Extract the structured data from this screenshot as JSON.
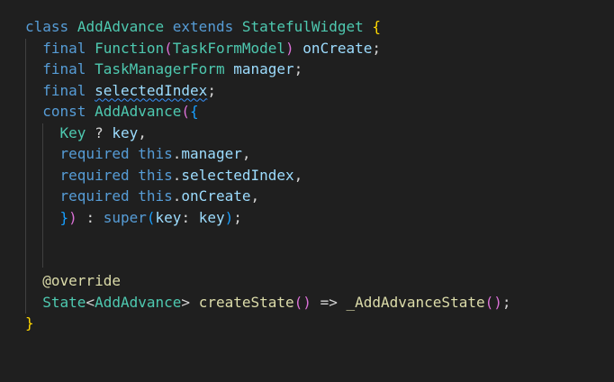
{
  "editor": {
    "language": "dart",
    "theme_colors": {
      "background": "#1f1f1f",
      "keyword": "#569cd6",
      "type": "#4ec9b0",
      "variable": "#9cdcfe",
      "function": "#dcdcaa",
      "plain": "#d4d4d4",
      "bracket_level_1": "#ffd700",
      "bracket_level_2": "#da70d6",
      "bracket_level_3": "#179fff",
      "squiggle": "#3794ff"
    },
    "lines": [
      [
        {
          "t": "class",
          "c": "kw"
        },
        {
          "t": " ",
          "c": "plain"
        },
        {
          "t": "AddAdvance",
          "c": "type"
        },
        {
          "t": " ",
          "c": "plain"
        },
        {
          "t": "extends",
          "c": "kw"
        },
        {
          "t": " ",
          "c": "plain"
        },
        {
          "t": "StatefulWidget",
          "c": "type"
        },
        {
          "t": " ",
          "c": "plain"
        },
        {
          "t": "{",
          "c": "br1"
        }
      ],
      [
        {
          "t": "  ",
          "c": "plain"
        },
        {
          "t": "final",
          "c": "kw"
        },
        {
          "t": " ",
          "c": "plain"
        },
        {
          "t": "Function",
          "c": "type"
        },
        {
          "t": "(",
          "c": "br2"
        },
        {
          "t": "TaskFormModel",
          "c": "type"
        },
        {
          "t": ")",
          "c": "br2"
        },
        {
          "t": " ",
          "c": "plain"
        },
        {
          "t": "onCreate",
          "c": "var"
        },
        {
          "t": ";",
          "c": "plain"
        }
      ],
      [
        {
          "t": "  ",
          "c": "plain"
        },
        {
          "t": "final",
          "c": "kw"
        },
        {
          "t": " ",
          "c": "plain"
        },
        {
          "t": "TaskManagerForm",
          "c": "type"
        },
        {
          "t": " ",
          "c": "plain"
        },
        {
          "t": "manager",
          "c": "var"
        },
        {
          "t": ";",
          "c": "plain"
        }
      ],
      [
        {
          "t": "  ",
          "c": "plain"
        },
        {
          "t": "final",
          "c": "kw"
        },
        {
          "t": " ",
          "c": "plain"
        },
        {
          "t": "selectedIndex",
          "c": "var",
          "squiggle": true
        },
        {
          "t": ";",
          "c": "plain"
        }
      ],
      [
        {
          "t": "  ",
          "c": "plain"
        },
        {
          "t": "const",
          "c": "kw"
        },
        {
          "t": " ",
          "c": "plain"
        },
        {
          "t": "AddAdvance",
          "c": "type"
        },
        {
          "t": "(",
          "c": "br2"
        },
        {
          "t": "{",
          "c": "br3"
        }
      ],
      [
        {
          "t": "    ",
          "c": "plain"
        },
        {
          "t": "Key",
          "c": "type"
        },
        {
          "t": " ? ",
          "c": "plain"
        },
        {
          "t": "key",
          "c": "var"
        },
        {
          "t": ",",
          "c": "plain"
        }
      ],
      [
        {
          "t": "    ",
          "c": "plain"
        },
        {
          "t": "required",
          "c": "kw"
        },
        {
          "t": " ",
          "c": "plain"
        },
        {
          "t": "this",
          "c": "kw"
        },
        {
          "t": ".",
          "c": "plain"
        },
        {
          "t": "manager",
          "c": "var"
        },
        {
          "t": ",",
          "c": "plain"
        }
      ],
      [
        {
          "t": "    ",
          "c": "plain"
        },
        {
          "t": "required",
          "c": "kw"
        },
        {
          "t": " ",
          "c": "plain"
        },
        {
          "t": "this",
          "c": "kw"
        },
        {
          "t": ".",
          "c": "plain"
        },
        {
          "t": "selectedIndex",
          "c": "var"
        },
        {
          "t": ",",
          "c": "plain"
        }
      ],
      [
        {
          "t": "    ",
          "c": "plain"
        },
        {
          "t": "required",
          "c": "kw"
        },
        {
          "t": " ",
          "c": "plain"
        },
        {
          "t": "this",
          "c": "kw"
        },
        {
          "t": ".",
          "c": "plain"
        },
        {
          "t": "onCreate",
          "c": "var"
        },
        {
          "t": ",",
          "c": "plain"
        }
      ],
      [
        {
          "t": "    ",
          "c": "plain"
        },
        {
          "t": "}",
          "c": "br3"
        },
        {
          "t": ")",
          "c": "br2"
        },
        {
          "t": " : ",
          "c": "plain"
        },
        {
          "t": "super",
          "c": "kw"
        },
        {
          "t": "(",
          "c": "br3"
        },
        {
          "t": "key",
          "c": "var"
        },
        {
          "t": ": ",
          "c": "plain"
        },
        {
          "t": "key",
          "c": "var"
        },
        {
          "t": ")",
          "c": "br3"
        },
        {
          "t": ";",
          "c": "plain"
        }
      ],
      [],
      [],
      [
        {
          "t": "  ",
          "c": "plain"
        },
        {
          "t": "@override",
          "c": "anno"
        }
      ],
      [
        {
          "t": "  ",
          "c": "plain"
        },
        {
          "t": "State",
          "c": "type"
        },
        {
          "t": "<",
          "c": "plain"
        },
        {
          "t": "AddAdvance",
          "c": "type"
        },
        {
          "t": ">",
          "c": "plain"
        },
        {
          "t": " ",
          "c": "plain"
        },
        {
          "t": "createState",
          "c": "fn"
        },
        {
          "t": "(",
          "c": "br2"
        },
        {
          "t": ")",
          "c": "br2"
        },
        {
          "t": " => ",
          "c": "plain"
        },
        {
          "t": "_AddAdvanceState",
          "c": "fn"
        },
        {
          "t": "(",
          "c": "br2"
        },
        {
          "t": ")",
          "c": "br2"
        },
        {
          "t": ";",
          "c": "plain"
        }
      ],
      [
        {
          "t": "}",
          "c": "br1"
        }
      ]
    ]
  }
}
